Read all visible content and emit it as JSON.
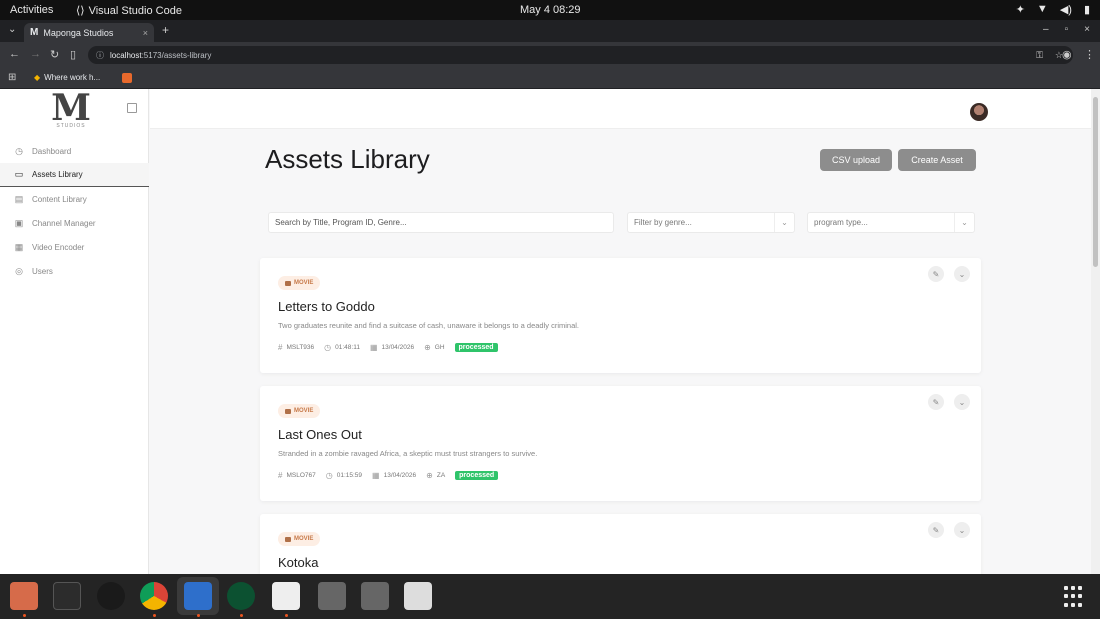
{
  "system": {
    "activities": "Activities",
    "app_name": "Visual Studio Code",
    "clock": "May 4  08:29"
  },
  "browser": {
    "tab_title": "Maponga Studios",
    "url_host": "localhost",
    "url_path": ":5173/assets-library",
    "bookmark": "Where work h..."
  },
  "sidebar": {
    "logo_letter": "M",
    "logo_sub": "STUDIOS",
    "items": [
      {
        "label": "Dashboard",
        "icon": "dashboard-icon"
      },
      {
        "label": "Assets Library",
        "icon": "folder-icon"
      },
      {
        "label": "Content Library",
        "icon": "library-icon"
      },
      {
        "label": "Channel Manager",
        "icon": "channel-icon"
      },
      {
        "label": "Video Encoder",
        "icon": "video-icon"
      },
      {
        "label": "Users",
        "icon": "users-icon"
      }
    ]
  },
  "main": {
    "title": "Assets Library",
    "csv_button": "CSV upload",
    "create_button": "Create Asset",
    "search_placeholder": "Search by Title, Program ID, Genre...",
    "genre_placeholder": "Filter by genre...",
    "type_placeholder": "program type..."
  },
  "assets": [
    {
      "type": "MOVIE",
      "title": "Letters to Goddo",
      "description": "Two graduates reunite and find a suitcase of cash, unaware it belongs to a deadly criminal.",
      "program_id": "MSLT936",
      "duration": "01:48:11",
      "date": "13/04/2026",
      "country": "GH",
      "status": "processed"
    },
    {
      "type": "MOVIE",
      "title": "Last Ones Out",
      "description": "Stranded in a zombie ravaged Africa, a skeptic must trust strangers to survive.",
      "program_id": "MSLO767",
      "duration": "01:15:59",
      "date": "13/04/2026",
      "country": "ZA",
      "status": "processed"
    },
    {
      "type": "MOVIE",
      "title": "Kotoka"
    }
  ],
  "colors": {
    "status_processed": "#2fc46a",
    "pill_bg": "#fdeee4",
    "button_gray": "#8d8d8d"
  }
}
